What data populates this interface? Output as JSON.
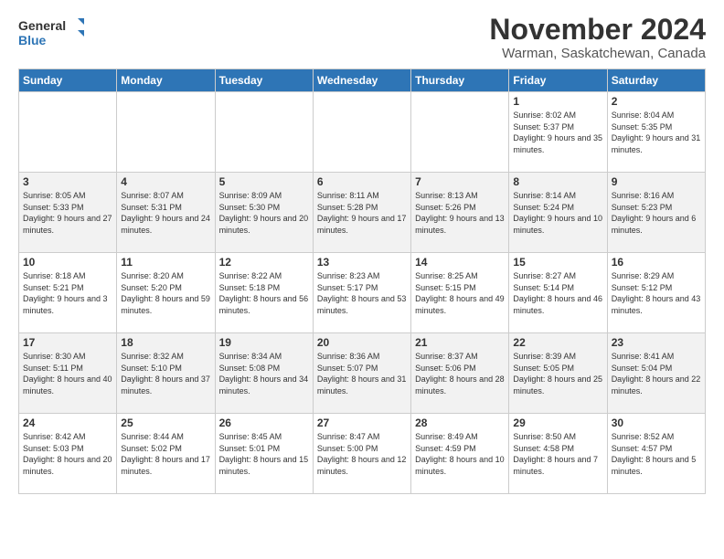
{
  "logo": {
    "line1": "General",
    "line2": "Blue"
  },
  "title": "November 2024",
  "location": "Warman, Saskatchewan, Canada",
  "weekdays": [
    "Sunday",
    "Monday",
    "Tuesday",
    "Wednesday",
    "Thursday",
    "Friday",
    "Saturday"
  ],
  "weeks": [
    [
      {
        "day": "",
        "info": ""
      },
      {
        "day": "",
        "info": ""
      },
      {
        "day": "",
        "info": ""
      },
      {
        "day": "",
        "info": ""
      },
      {
        "day": "",
        "info": ""
      },
      {
        "day": "1",
        "info": "Sunrise: 8:02 AM\nSunset: 5:37 PM\nDaylight: 9 hours\nand 35 minutes."
      },
      {
        "day": "2",
        "info": "Sunrise: 8:04 AM\nSunset: 5:35 PM\nDaylight: 9 hours\nand 31 minutes."
      }
    ],
    [
      {
        "day": "3",
        "info": "Sunrise: 8:05 AM\nSunset: 5:33 PM\nDaylight: 9 hours\nand 27 minutes."
      },
      {
        "day": "4",
        "info": "Sunrise: 8:07 AM\nSunset: 5:31 PM\nDaylight: 9 hours\nand 24 minutes."
      },
      {
        "day": "5",
        "info": "Sunrise: 8:09 AM\nSunset: 5:30 PM\nDaylight: 9 hours\nand 20 minutes."
      },
      {
        "day": "6",
        "info": "Sunrise: 8:11 AM\nSunset: 5:28 PM\nDaylight: 9 hours\nand 17 minutes."
      },
      {
        "day": "7",
        "info": "Sunrise: 8:13 AM\nSunset: 5:26 PM\nDaylight: 9 hours\nand 13 minutes."
      },
      {
        "day": "8",
        "info": "Sunrise: 8:14 AM\nSunset: 5:24 PM\nDaylight: 9 hours\nand 10 minutes."
      },
      {
        "day": "9",
        "info": "Sunrise: 8:16 AM\nSunset: 5:23 PM\nDaylight: 9 hours\nand 6 minutes."
      }
    ],
    [
      {
        "day": "10",
        "info": "Sunrise: 8:18 AM\nSunset: 5:21 PM\nDaylight: 9 hours\nand 3 minutes."
      },
      {
        "day": "11",
        "info": "Sunrise: 8:20 AM\nSunset: 5:20 PM\nDaylight: 8 hours\nand 59 minutes."
      },
      {
        "day": "12",
        "info": "Sunrise: 8:22 AM\nSunset: 5:18 PM\nDaylight: 8 hours\nand 56 minutes."
      },
      {
        "day": "13",
        "info": "Sunrise: 8:23 AM\nSunset: 5:17 PM\nDaylight: 8 hours\nand 53 minutes."
      },
      {
        "day": "14",
        "info": "Sunrise: 8:25 AM\nSunset: 5:15 PM\nDaylight: 8 hours\nand 49 minutes."
      },
      {
        "day": "15",
        "info": "Sunrise: 8:27 AM\nSunset: 5:14 PM\nDaylight: 8 hours\nand 46 minutes."
      },
      {
        "day": "16",
        "info": "Sunrise: 8:29 AM\nSunset: 5:12 PM\nDaylight: 8 hours\nand 43 minutes."
      }
    ],
    [
      {
        "day": "17",
        "info": "Sunrise: 8:30 AM\nSunset: 5:11 PM\nDaylight: 8 hours\nand 40 minutes."
      },
      {
        "day": "18",
        "info": "Sunrise: 8:32 AM\nSunset: 5:10 PM\nDaylight: 8 hours\nand 37 minutes."
      },
      {
        "day": "19",
        "info": "Sunrise: 8:34 AM\nSunset: 5:08 PM\nDaylight: 8 hours\nand 34 minutes."
      },
      {
        "day": "20",
        "info": "Sunrise: 8:36 AM\nSunset: 5:07 PM\nDaylight: 8 hours\nand 31 minutes."
      },
      {
        "day": "21",
        "info": "Sunrise: 8:37 AM\nSunset: 5:06 PM\nDaylight: 8 hours\nand 28 minutes."
      },
      {
        "day": "22",
        "info": "Sunrise: 8:39 AM\nSunset: 5:05 PM\nDaylight: 8 hours\nand 25 minutes."
      },
      {
        "day": "23",
        "info": "Sunrise: 8:41 AM\nSunset: 5:04 PM\nDaylight: 8 hours\nand 22 minutes."
      }
    ],
    [
      {
        "day": "24",
        "info": "Sunrise: 8:42 AM\nSunset: 5:03 PM\nDaylight: 8 hours\nand 20 minutes."
      },
      {
        "day": "25",
        "info": "Sunrise: 8:44 AM\nSunset: 5:02 PM\nDaylight: 8 hours\nand 17 minutes."
      },
      {
        "day": "26",
        "info": "Sunrise: 8:45 AM\nSunset: 5:01 PM\nDaylight: 8 hours\nand 15 minutes."
      },
      {
        "day": "27",
        "info": "Sunrise: 8:47 AM\nSunset: 5:00 PM\nDaylight: 8 hours\nand 12 minutes."
      },
      {
        "day": "28",
        "info": "Sunrise: 8:49 AM\nSunset: 4:59 PM\nDaylight: 8 hours\nand 10 minutes."
      },
      {
        "day": "29",
        "info": "Sunrise: 8:50 AM\nSunset: 4:58 PM\nDaylight: 8 hours\nand 7 minutes."
      },
      {
        "day": "30",
        "info": "Sunrise: 8:52 AM\nSunset: 4:57 PM\nDaylight: 8 hours\nand 5 minutes."
      }
    ]
  ]
}
